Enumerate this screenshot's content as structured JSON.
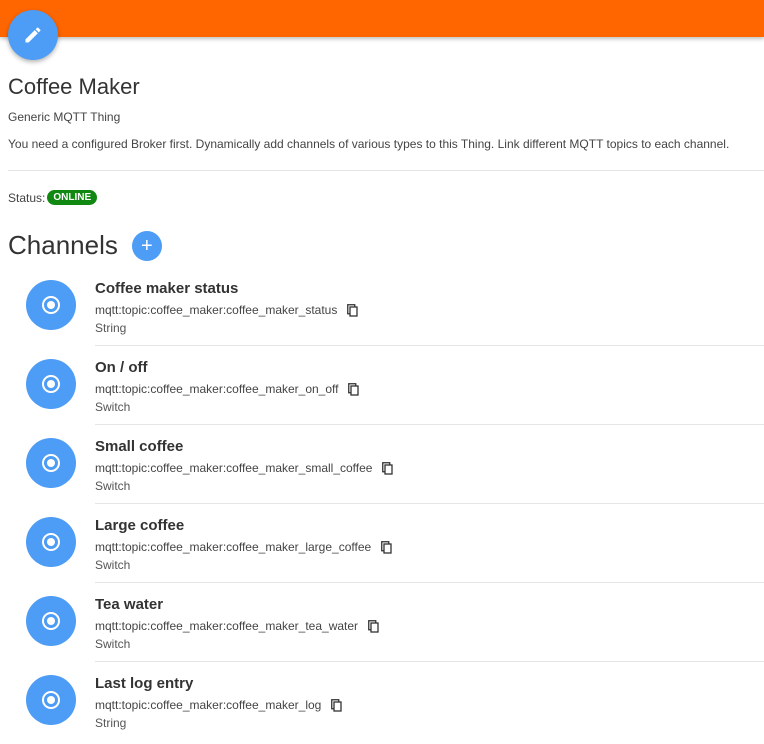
{
  "header": {
    "bar_color": "#ff6600",
    "edit_icon": "pencil-icon"
  },
  "thing": {
    "title": "Coffee Maker",
    "subtitle": "Generic MQTT Thing",
    "description": "You need a configured Broker first. Dynamically add channels of various types to this Thing. Link different MQTT topics to each channel.",
    "status_label": "Status:",
    "status": "ONLINE",
    "status_color": "#118811"
  },
  "channels": {
    "title": "Channels",
    "add_icon": "plus-icon",
    "items": [
      {
        "name": "Coffee maker status",
        "uid": "mqtt:topic:coffee_maker:coffee_maker_status",
        "type": "String"
      },
      {
        "name": "On / off",
        "uid": "mqtt:topic:coffee_maker:coffee_maker_on_off",
        "type": "Switch"
      },
      {
        "name": "Small coffee",
        "uid": "mqtt:topic:coffee_maker:coffee_maker_small_coffee",
        "type": "Switch"
      },
      {
        "name": "Large coffee",
        "uid": "mqtt:topic:coffee_maker:coffee_maker_large_coffee",
        "type": "Switch"
      },
      {
        "name": "Tea water",
        "uid": "mqtt:topic:coffee_maker:coffee_maker_tea_water",
        "type": "Switch"
      },
      {
        "name": "Last log entry",
        "uid": "mqtt:topic:coffee_maker:coffee_maker_log",
        "type": "String"
      }
    ]
  },
  "accent_color": "#4d9cf5"
}
